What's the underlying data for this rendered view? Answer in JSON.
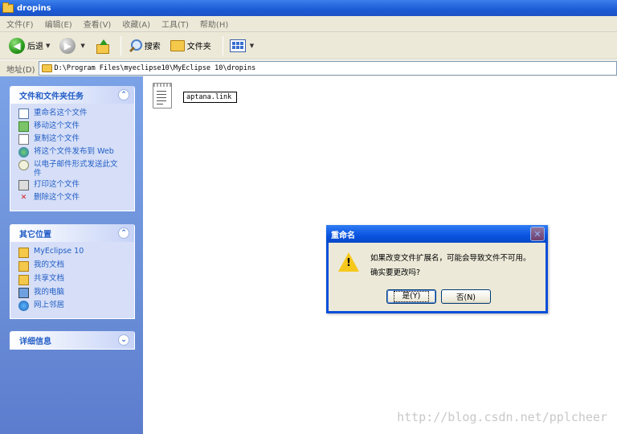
{
  "window": {
    "title": "dropins"
  },
  "menu": [
    "文件(F)",
    "编辑(E)",
    "查看(V)",
    "收藏(A)",
    "工具(T)",
    "帮助(H)"
  ],
  "toolbar": {
    "back": "后退",
    "search": "搜索",
    "folders": "文件夹"
  },
  "address": {
    "label": "地址(D)",
    "path": "D:\\Program Files\\myeclipse10\\MyEclipse 10\\dropins"
  },
  "tasks": {
    "title": "文件和文件夹任务",
    "collapse": "⌃",
    "items": [
      "重命名这个文件",
      "移动这个文件",
      "复制这个文件",
      "将这个文件发布到 Web",
      "以电子邮件形式发送此文件",
      "打印这个文件",
      "删除这个文件"
    ]
  },
  "places": {
    "title": "其它位置",
    "collapse": "⌃",
    "items": [
      "MyEclipse 10",
      "我的文档",
      "共享文档",
      "我的电脑",
      "网上邻居"
    ]
  },
  "details": {
    "title": "详细信息",
    "expand": "⌄"
  },
  "file": {
    "name": "aptana.link"
  },
  "dialog": {
    "title": "重命名",
    "close": "✕",
    "line1": "如果改变文件扩展名，可能会导致文件不可用。",
    "line2": "确实要更改吗?",
    "yes": "是(Y)",
    "no": "否(N)"
  },
  "watermark": "http://blog.csdn.net/pplcheer",
  "colors": {
    "title_bar": "#1b5bd6",
    "sidebar": "#6b8fd8",
    "panel": "#d6dff7",
    "link": "#215dc6",
    "chrome": "#ece9d8"
  }
}
